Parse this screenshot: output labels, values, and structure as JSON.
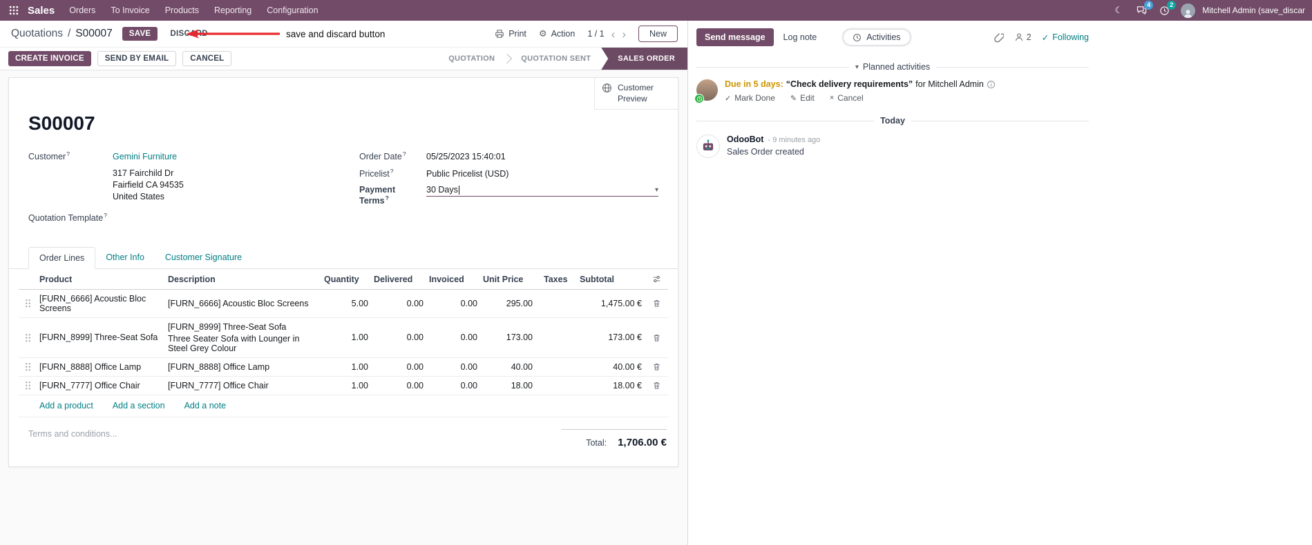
{
  "colors": {
    "primary": "#714B67",
    "link_teal": "#017e84",
    "modified_value_blue": "#2a62cf",
    "due_warning_orange": "#cf9400",
    "annotation_red": "#e8282d",
    "active_stage_purple": "#6d4a63"
  },
  "icons": {
    "dropdown_caret": "▾",
    "collapse_caret": "▾",
    "pager_prev": "‹",
    "pager_next": "›",
    "gear": "⚙",
    "moon": "☾",
    "check": "✓",
    "pencil": "✎",
    "cross": "×",
    "help": "?"
  },
  "navbar": {
    "app_name": "Sales",
    "menu": [
      "Orders",
      "To Invoice",
      "Products",
      "Reporting",
      "Configuration"
    ],
    "messages_badge": "4",
    "activities_badge": "2",
    "user_name": "Mitchell Admin (save_discar"
  },
  "control_panel": {
    "breadcrumb_parent": "Quotations",
    "breadcrumb_separator": "/",
    "breadcrumb_current": "S00007",
    "save": "SAVE",
    "discard": "DISCARD",
    "print": "Print",
    "action": "Action",
    "pager": "1 / 1",
    "new": "New"
  },
  "annotation": {
    "text": "save and discard button"
  },
  "statusbar": {
    "buttons": [
      "CREATE INVOICE",
      "SEND BY EMAIL",
      "CANCEL"
    ],
    "stages": [
      "QUOTATION",
      "QUOTATION SENT",
      "SALES ORDER"
    ],
    "active_stage": "SALES ORDER"
  },
  "form": {
    "customer_preview": "Customer Preview",
    "title": "S00007",
    "customer_label": "Customer",
    "customer_value": "Gemini Furniture",
    "address": [
      "317 Fairchild Dr",
      "Fairfield CA 94535",
      "United States"
    ],
    "quotation_template_label": "Quotation Template",
    "order_date_label": "Order Date",
    "order_date_value": "05/25/2023 15:40:01",
    "pricelist_label": "Pricelist",
    "pricelist_value": "Public Pricelist (USD)",
    "payment_terms_label": "Payment Terms",
    "payment_terms_value": "30 Days",
    "tabs": [
      "Order Lines",
      "Other Info",
      "Customer Signature"
    ],
    "table": {
      "columns": [
        "Product",
        "Description",
        "Quantity",
        "Delivered",
        "Invoiced",
        "Unit Price",
        "Taxes",
        "Subtotal"
      ],
      "rows": [
        {
          "product": "[FURN_6666] Acoustic Bloc Screens",
          "description": "[FURN_6666] Acoustic Bloc Screens",
          "quantity": "5.00",
          "delivered": "0.00",
          "invoiced": "0.00",
          "unit_price": "295.00",
          "taxes": "",
          "subtotal": "1,475.00 €"
        },
        {
          "product": "[FURN_8999] Three-Seat Sofa",
          "description": "[FURN_8999] Three-Seat Sofa",
          "description2": "Three Seater Sofa with Lounger in Steel Grey Colour",
          "quantity": "1.00",
          "delivered": "0.00",
          "invoiced": "0.00",
          "unit_price": "173.00",
          "taxes": "",
          "subtotal": "173.00 €"
        },
        {
          "product": "[FURN_8888] Office Lamp",
          "description": "[FURN_8888] Office Lamp",
          "quantity": "1.00",
          "delivered": "0.00",
          "invoiced": "0.00",
          "unit_price": "40.00",
          "taxes": "",
          "subtotal": "40.00 €"
        },
        {
          "product": "[FURN_7777] Office Chair",
          "description": "[FURN_7777] Office Chair",
          "quantity": "1.00",
          "delivered": "0.00",
          "invoiced": "0.00",
          "unit_price": "18.00",
          "taxes": "",
          "subtotal": "18.00 €"
        }
      ],
      "footer_links": [
        "Add a product",
        "Add a section",
        "Add a note"
      ]
    },
    "terms_placeholder": "Terms and conditions...",
    "total_label": "Total:",
    "total_value": "1,706.00 €"
  },
  "chatter": {
    "send_message": "Send message",
    "log_note": "Log note",
    "activities_tab": "Activities",
    "followers_count": "2",
    "following": "Following",
    "planned_header": "Planned activities",
    "activity": {
      "due": "Due in 5 days:",
      "summary": "“Check delivery requirements”",
      "assignee": "for Mitchell Admin",
      "mark_done": "Mark Done",
      "edit": "Edit",
      "cancel": "Cancel"
    },
    "date_divider": "Today",
    "message": {
      "author": "OdooBot",
      "time": "- 9 minutes ago",
      "body": "Sales Order created"
    }
  }
}
